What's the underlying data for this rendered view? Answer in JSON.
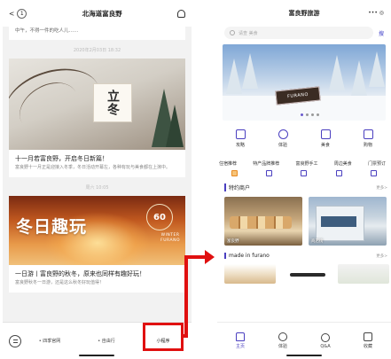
{
  "left": {
    "nav": {
      "back_badge": "1",
      "title": "北海道富良野"
    },
    "top_card_text": "中午，不得一件的吃人儿……",
    "timestamp1": "2020年2月03日 18:32",
    "article1": {
      "image_text": "立冬",
      "title": "十一月若富良野，开启冬日新篇！",
      "desc": "富良野十一月正是迎接入冬季，冬日活动开幕左，各种有玩与美食都在上演中。"
    },
    "timestamp2": "周六 10:05",
    "article2": {
      "image_text": "冬日趣玩",
      "badge": "60",
      "badge_sub": "WINTER\nFURANO",
      "title": "一日游丨富良野的秋冬，原来也同样有趣好玩！",
      "desc": "富良野秋冬一日游，还是这么秋冬好玩值得！"
    },
    "bottom_menu": [
      "• 四季官网",
      "• 自由行",
      "小程序"
    ]
  },
  "right": {
    "nav": {
      "title": "富良野旅游",
      "dots": "••• ◎"
    },
    "search": {
      "placeholder": "请查 美食",
      "button": "搜"
    },
    "banner_sign": "FURANO",
    "icons": [
      {
        "label": "攻略"
      },
      {
        "label": "体验"
      },
      {
        "label": "美食"
      },
      {
        "label": "购物"
      }
    ],
    "text_row": [
      "住宿推荐",
      "特产品牌推荐",
      "富良野手工",
      "周边美食",
      "门票预订"
    ],
    "section_shops": {
      "title": "特约商户",
      "more": "更多>"
    },
    "shops": [
      {
        "caption": "富良野"
      },
      {
        "caption": "商店街"
      }
    ],
    "section_made": {
      "title": "made in furano",
      "more": "更多>"
    },
    "tabs": [
      {
        "label": "主页"
      },
      {
        "label": "体验"
      },
      {
        "label": "Q&A"
      },
      {
        "label": "收藏"
      }
    ]
  },
  "colors": {
    "accent": "#4a3fc0",
    "highlight": "#e01010"
  }
}
